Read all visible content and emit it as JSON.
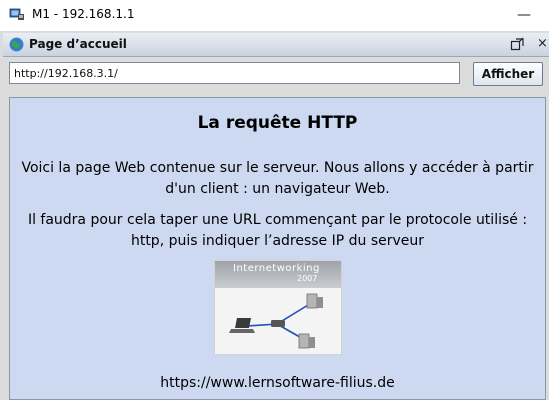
{
  "window": {
    "title": "M1 - 192.168.1.1",
    "minimize_glyph": "—",
    "icon": "network-computer-icon"
  },
  "inner_window": {
    "title": "Page d’accueil",
    "icon": "web-browser-icon",
    "restore_icon": "restore-window-icon",
    "close_glyph": "×"
  },
  "address_bar": {
    "url": "http://192.168.3.1/",
    "button_label": "Afficher"
  },
  "page": {
    "heading": "La requête HTTP",
    "paragraph1": "Voici la page Web contenue sur le serveur. Nous allons y accéder à partir d'un client : un navigateur Web.",
    "paragraph2": "Il faudra pour cela taper une URL commençant par le protocole utilisé : http, puis indiquer l’adresse IP du serveur",
    "image": {
      "title": "Internetworking",
      "year": "2007",
      "icon": "network-diagram-image"
    },
    "link": "https://www.lernsoftware-filius.de"
  },
  "colors": {
    "page_background": "#cdd9f1",
    "frame_background": "#dcdcdc"
  }
}
